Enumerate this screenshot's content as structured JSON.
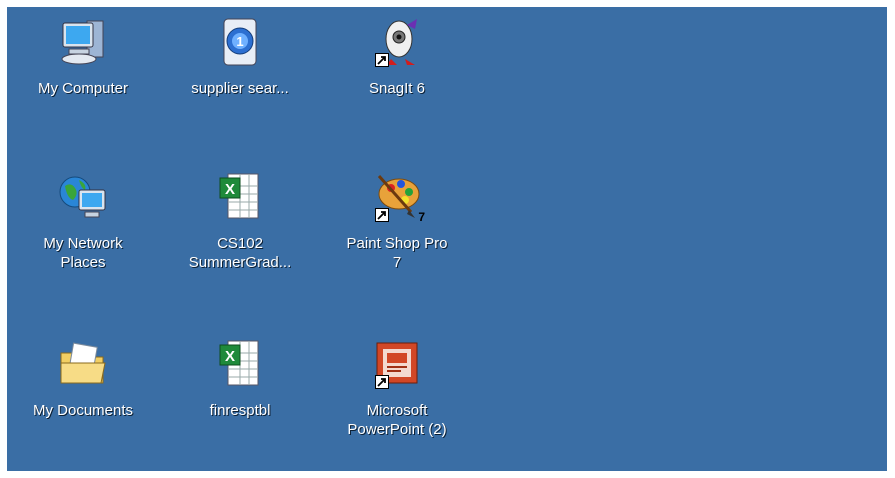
{
  "desktop": {
    "background_color": "#3a6ea5",
    "icons": [
      {
        "label": "My Computer",
        "icon": "computer-icon",
        "shortcut": false
      },
      {
        "label": "supplier  sear...",
        "icon": "document-icon",
        "shortcut": false
      },
      {
        "label": "SnagIt 6",
        "icon": "snagit-icon",
        "shortcut": true
      },
      {
        "label": "My Network\nPlaces",
        "icon": "network-places-icon",
        "shortcut": false
      },
      {
        "label": "CS102\nSummerGrad...",
        "icon": "excel-icon",
        "shortcut": false
      },
      {
        "label": "Paint Shop Pro\n7",
        "icon": "paintshop-icon",
        "shortcut": true,
        "badge": "7"
      },
      {
        "label": "My Documents",
        "icon": "folder-icon",
        "shortcut": false
      },
      {
        "label": "finresptbl",
        "icon": "excel-icon",
        "shortcut": false
      },
      {
        "label": "Microsoft\nPowerPoint (2)",
        "icon": "powerpoint-icon",
        "shortcut": true
      }
    ]
  }
}
